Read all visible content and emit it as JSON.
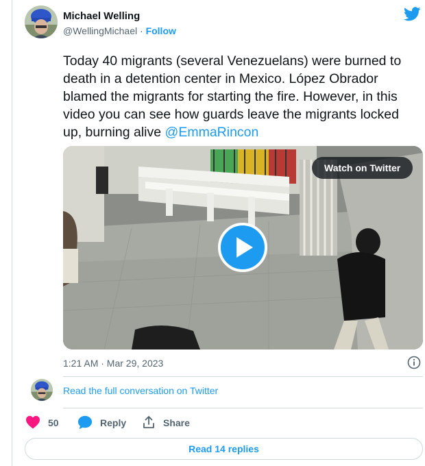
{
  "author": {
    "name": "Michael Welling",
    "handle": "@WellingMichael",
    "separator": " · ",
    "follow_label": "Follow"
  },
  "tweet": {
    "text": "Today 40 migrants (several Venezuelans) were burned to death in a detention center in Mexico. López Obrador blamed the migrants for starting the fire. However, in this video you can see how guards leave the migrants locked up, burning alive ",
    "mention": "@EmmaRincon",
    "timestamp": "1:21 AM · Mar 29, 2023"
  },
  "media": {
    "badge_label": "Watch on Twitter"
  },
  "conversation": {
    "label": "Read the full conversation on Twitter"
  },
  "actions": {
    "like_count": "50",
    "reply_label": "Reply",
    "share_label": "Share"
  },
  "footer": {
    "read_replies_label": "Read 14 replies"
  },
  "colors": {
    "brand": "#1d9bf0",
    "like": "#f91880",
    "text_primary": "#0f1419",
    "text_secondary": "#536471",
    "border": "#cfd9de"
  },
  "icons": [
    "twitter-bird-icon",
    "play-icon",
    "info-icon",
    "heart-icon",
    "reply-bubble-icon",
    "share-icon"
  ]
}
